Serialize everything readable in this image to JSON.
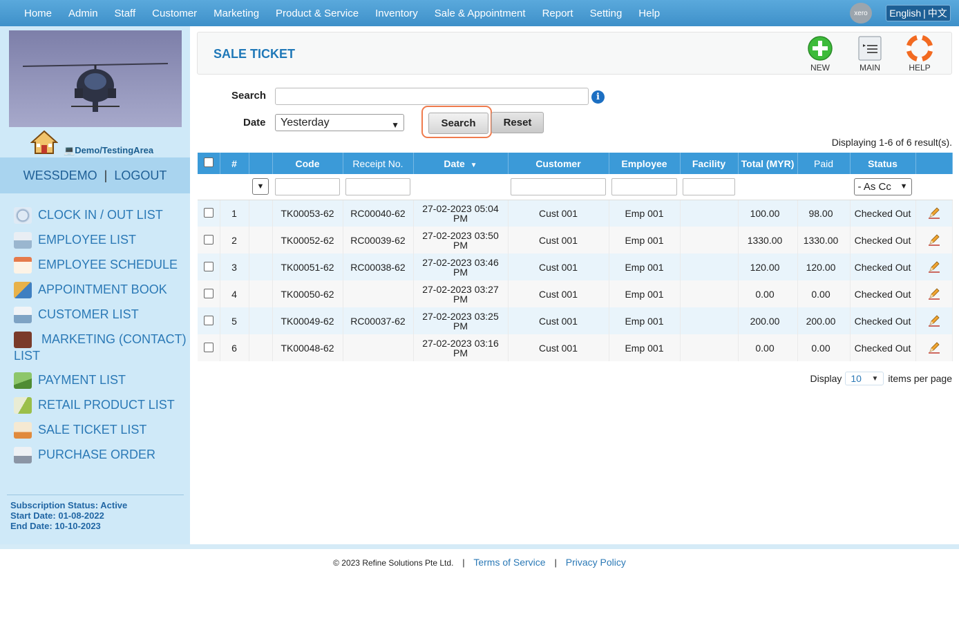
{
  "topnav": {
    "items": [
      "Home",
      "Admin",
      "Staff",
      "Customer",
      "Marketing",
      "Product & Service",
      "Inventory",
      "Sale & Appointment",
      "Report",
      "Setting",
      "Help"
    ],
    "xero_label": "xero",
    "lang_en": "English",
    "lang_sep": "|",
    "lang_zh": "中文"
  },
  "sidebar": {
    "area_link": "Demo/TestingArea",
    "username": "WESSDEMO",
    "user_sep": "|",
    "logout": "LOGOUT",
    "items": [
      {
        "label": "CLOCK IN / OUT LIST",
        "icon": "clock-icon"
      },
      {
        "label": "EMPLOYEE LIST",
        "icon": "employee-icon"
      },
      {
        "label": "EMPLOYEE SCHEDULE",
        "icon": "calendar-icon"
      },
      {
        "label": "APPOINTMENT BOOK",
        "icon": "appointment-icon"
      },
      {
        "label": "CUSTOMER LIST",
        "icon": "customer-icon"
      },
      {
        "label": "MARKETING (CONTACT) LIST",
        "icon": "marketing-icon"
      },
      {
        "label": "PAYMENT LIST",
        "icon": "payment-icon"
      },
      {
        "label": "RETAIL PRODUCT LIST",
        "icon": "product-icon"
      },
      {
        "label": "SALE TICKET LIST",
        "icon": "ticket-icon"
      },
      {
        "label": "PURCHASE ORDER",
        "icon": "purchase-icon"
      }
    ],
    "subscription": {
      "status": "Subscription Status: Active",
      "start": "Start Date: 01-08-2022",
      "end": "End Date: 10-10-2023"
    }
  },
  "page": {
    "title": "SALE TICKET",
    "toolbar": {
      "new": "NEW",
      "main": "MAIN",
      "help": "HELP"
    },
    "search_label": "Search",
    "search_value": "",
    "date_label": "Date",
    "date_value": "Yesterday",
    "search_button": "Search",
    "reset_button": "Reset",
    "result_count": "Displaying 1-6 of 6 result(s)."
  },
  "table": {
    "headers": {
      "num": "#",
      "code": "Code",
      "receipt": "Receipt No.",
      "date": "Date",
      "customer": "Customer",
      "employee": "Employee",
      "facility": "Facility",
      "total": "Total (MYR)",
      "paid": "Paid",
      "status": "Status"
    },
    "status_filter": "- As Cc",
    "rows": [
      {
        "num": "1",
        "code": "TK00053-62",
        "receipt": "RC00040-62",
        "date": "27-02-2023 05:04",
        "ampm": "PM",
        "customer": "Cust 001",
        "employee": "Emp 001",
        "facility": "",
        "total": "100.00",
        "paid": "98.00",
        "status": "Checked Out"
      },
      {
        "num": "2",
        "code": "TK00052-62",
        "receipt": "RC00039-62",
        "date": "27-02-2023 03:50",
        "ampm": "PM",
        "customer": "Cust 001",
        "employee": "Emp 001",
        "facility": "",
        "total": "1330.00",
        "paid": "1330.00",
        "status": "Checked Out"
      },
      {
        "num": "3",
        "code": "TK00051-62",
        "receipt": "RC00038-62",
        "date": "27-02-2023 03:46",
        "ampm": "PM",
        "customer": "Cust 001",
        "employee": "Emp 001",
        "facility": "",
        "total": "120.00",
        "paid": "120.00",
        "status": "Checked Out"
      },
      {
        "num": "4",
        "code": "TK00050-62",
        "receipt": "",
        "date": "27-02-2023 03:27",
        "ampm": "PM",
        "customer": "Cust 001",
        "employee": "Emp 001",
        "facility": "",
        "total": "0.00",
        "paid": "0.00",
        "status": "Checked Out"
      },
      {
        "num": "5",
        "code": "TK00049-62",
        "receipt": "RC00037-62",
        "date": "27-02-2023 03:25",
        "ampm": "PM",
        "customer": "Cust 001",
        "employee": "Emp 001",
        "facility": "",
        "total": "200.00",
        "paid": "200.00",
        "status": "Checked Out"
      },
      {
        "num": "6",
        "code": "TK00048-62",
        "receipt": "",
        "date": "27-02-2023 03:16",
        "ampm": "PM",
        "customer": "Cust 001",
        "employee": "Emp 001",
        "facility": "",
        "total": "0.00",
        "paid": "0.00",
        "status": "Checked Out"
      }
    ]
  },
  "pager": {
    "display_label": "Display",
    "per_page_value": "10",
    "suffix": "items per page"
  },
  "footer": {
    "copyright": "© 2023 Refine Solutions Pte Ltd.",
    "sep": "|",
    "terms": "Terms of Service",
    "privacy": "Privacy Policy"
  },
  "colors": {
    "topbar": "#4a9cd4",
    "accent": "#1f78b8",
    "header_row": "#3b9ad8",
    "focus_ring": "#ef7b4d"
  }
}
